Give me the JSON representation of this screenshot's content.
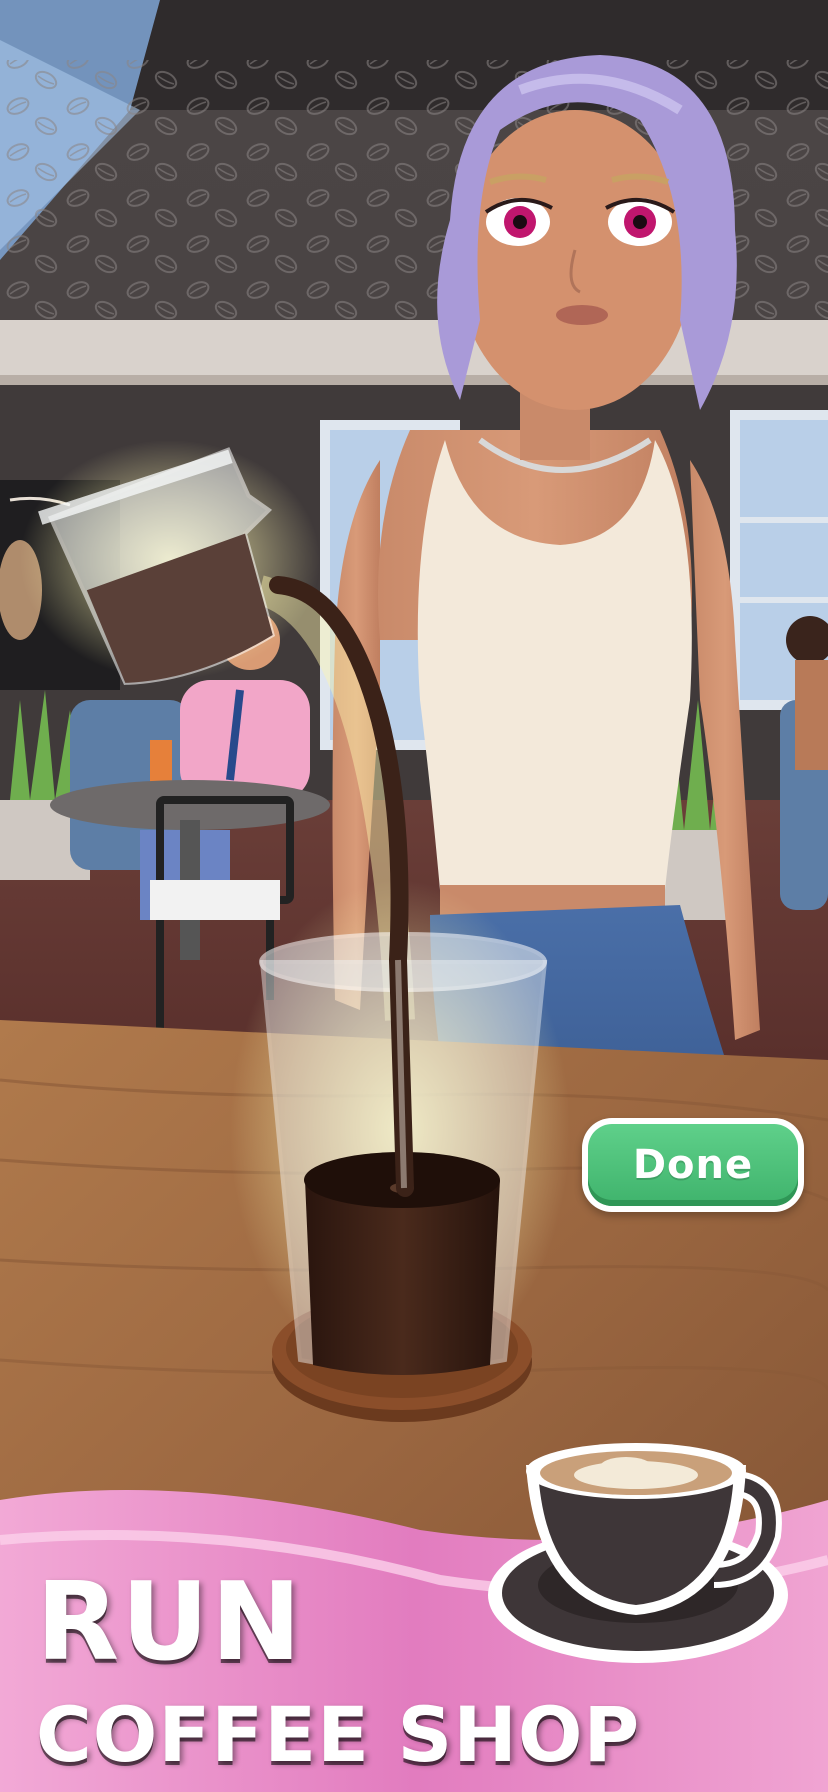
{
  "hud": {
    "done_label": "Done"
  },
  "promo": {
    "line1": "RUN",
    "line2": "COFFEE SHOP"
  },
  "colors": {
    "done_button": "#4cc47c",
    "promo_ribbon": "#e88cc8",
    "coffee": "#3b2218",
    "character_hair": "#a99ad8"
  },
  "icons": {
    "cup": "coffee-cup-icon"
  }
}
